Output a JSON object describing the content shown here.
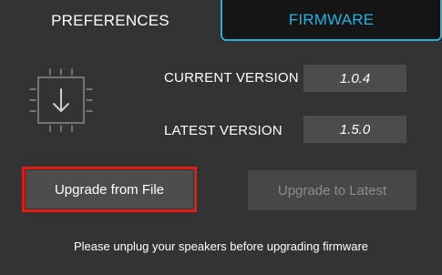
{
  "tabs": {
    "preferences": "PREFERENCES",
    "firmware": "FIRMWARE"
  },
  "versions": {
    "current_label": "CURRENT VERSION",
    "current_value": "1.0.4",
    "latest_label": "LATEST VERSION",
    "latest_value": "1.5.0"
  },
  "buttons": {
    "upgrade_from_file": "Upgrade from File",
    "upgrade_to_latest": "Upgrade to Latest"
  },
  "footer": {
    "note": "Please unplug your speakers before upgrading firmware"
  },
  "icons": {
    "chip": "chip-download-icon"
  },
  "colors": {
    "accent": "#27b0dd",
    "highlight": "#e21b13",
    "background": "#333333"
  }
}
